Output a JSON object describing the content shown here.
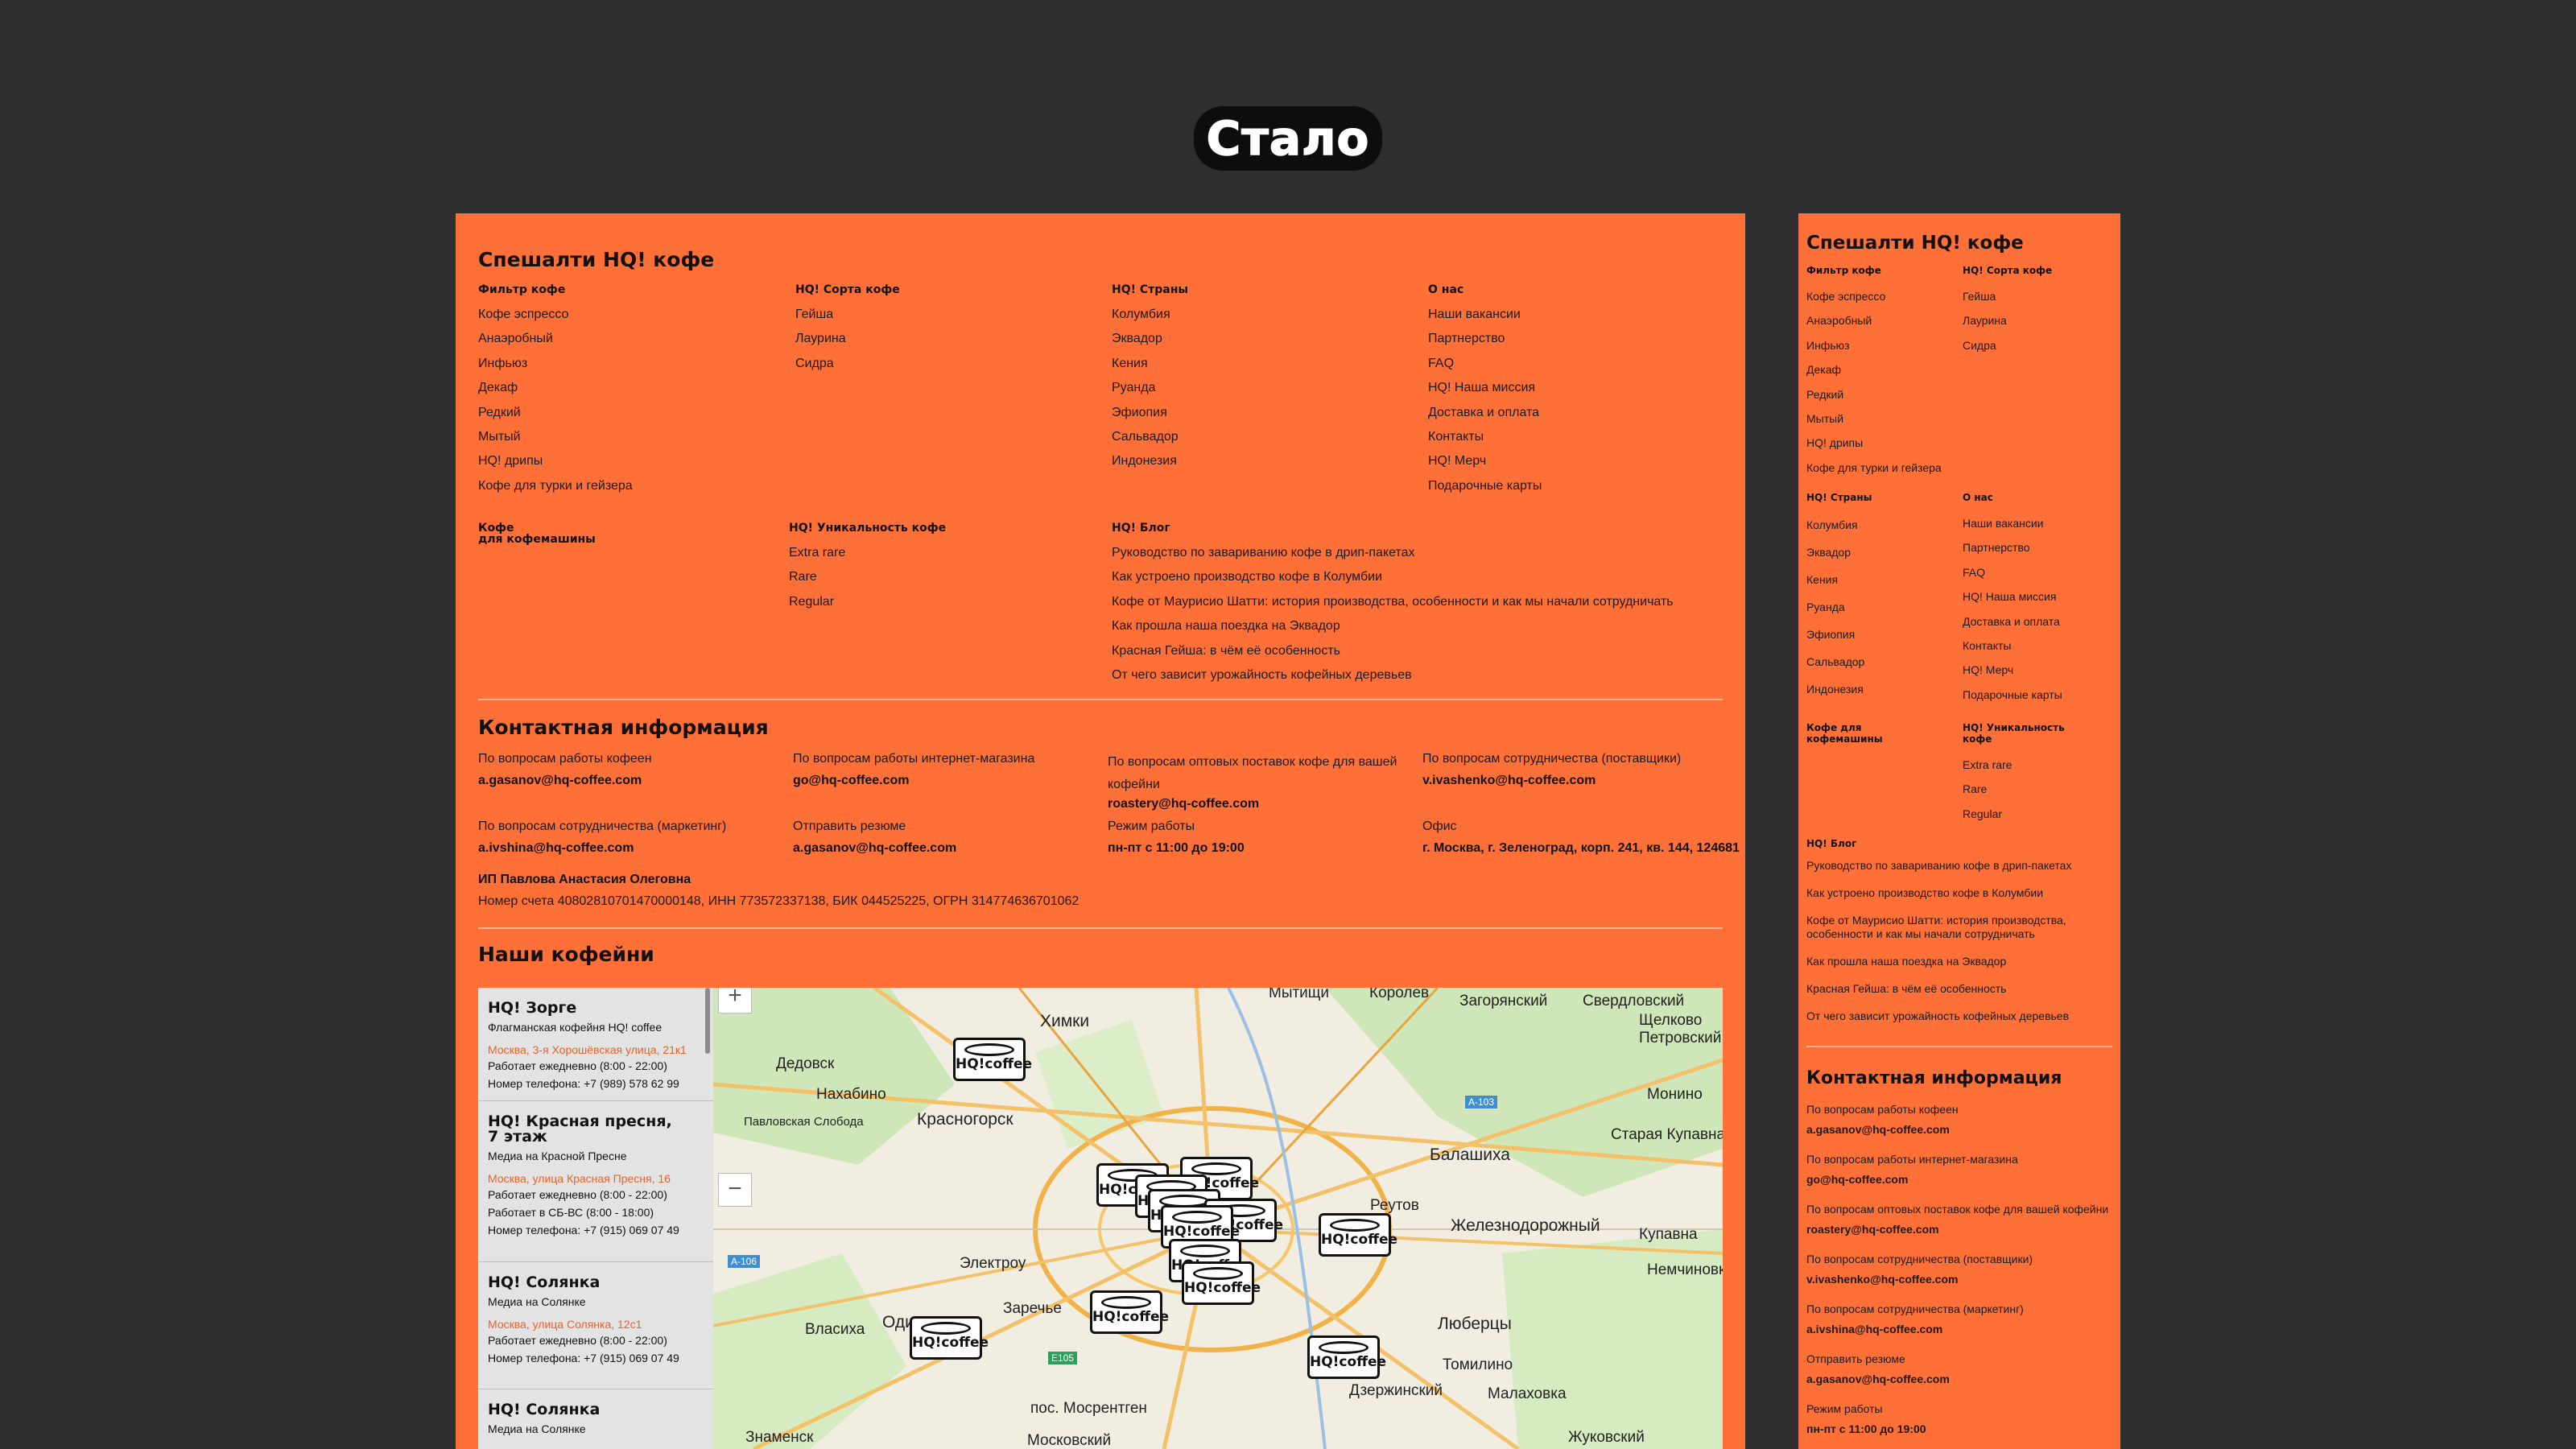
{
  "heading": "Стало",
  "desktop": {
    "catalog_title": "Спешалти HQ! кофе",
    "columns": [
      {
        "title": "Фильтр кофе",
        "items": [
          "Кофе эспрессо",
          "Анаэробный",
          "Инфьюз",
          "Декаф",
          "Редкий",
          "Мытый",
          "HQ! дрипы",
          "Кофе для турки и гейзера"
        ]
      },
      {
        "title": "HQ! Сорта кофе",
        "items": [
          "Гейша",
          "Лаурина",
          "Сидра"
        ]
      },
      {
        "title": "HQ! Страны",
        "items": [
          "Колумбия",
          "Эквадор",
          "Кения",
          "Руанда",
          "Эфиопия",
          "Сальвадор",
          "Индонезия"
        ]
      },
      {
        "title": "О нас",
        "items": [
          "Наши вакансии",
          "Партнерство",
          "FAQ",
          "HQ! Наша миссия",
          "Доставка и оплата",
          "Контакты",
          "HQ! Мерч",
          "Подарочные карты"
        ]
      }
    ],
    "row2": [
      {
        "title_line1": "Кофе",
        "title_line2": "для кофемашины",
        "items": []
      },
      {
        "title": "HQ! Уникальность кофе",
        "items": [
          "Extra rare",
          "Rare",
          "Regular"
        ]
      },
      {
        "title": "HQ! Блог",
        "items": [
          "Руководство по завариванию кофе в дрип-пакетах",
          "Как устроено производство кофе в Колумбии",
          "Кофе от Маурисио Шатти: история производства, особенности и как мы начали сотрудничать",
          "Как прошла наша поездка на Эквадор",
          "Красная Гейша: в чём её особенность",
          "От чего зависит урожайность кофейных деревьев"
        ]
      }
    ],
    "contacts_title": "Контактная информация",
    "contacts": [
      {
        "label": "По вопросам работы кофеен",
        "value": "a.gasanov@hq-coffee.com"
      },
      {
        "label": "По вопросам работы интернет-магазина",
        "value": "go@hq-coffee.com"
      },
      {
        "label": "По вопросам оптовых поставок кофе для вашей кофейни",
        "value": "roastery@hq-coffee.com"
      },
      {
        "label": "По вопросам сотрудничества (поставщики)",
        "value": "v.ivashenko@hq-coffee.com"
      },
      {
        "label": "По вопросам сотрудничества (маркетинг)",
        "value": "a.ivshina@hq-coffee.com"
      },
      {
        "label": "Отправить резюме",
        "value": "a.gasanov@hq-coffee.com"
      },
      {
        "label": "Режим работы",
        "value": "пн-пт с 11:00 до 19:00"
      },
      {
        "label": "Офис",
        "value": "г. Москва, г. Зеленоград, корп. 241, кв. 144, 124681"
      }
    ],
    "legal_name": "ИП Павлова Анастасия Олеговна",
    "legal_details": "Номер счета 40802810701470000148, ИНН 773572337138, БИК 044525225, ОГРН 314774636701062",
    "cafes_title": "Наши кофейни",
    "shops": [
      {
        "name": "HQ! Зорге",
        "desc": "Флагманская кофейня HQ! coffee",
        "address": "Москва, 3-я Хорошёвская улица, 21к1",
        "hours": [
          "Работает ежедневно (8:00 - 22:00)"
        ],
        "phone": "Номер телефона: +7 (989) 578 62 99"
      },
      {
        "name_line1": "HQ! Красная пресня,",
        "name_line2": "7 этаж",
        "desc": "Медиа на Красной Пресне",
        "address": "Москва, улица Красная Пресня, 16",
        "hours": [
          "Работает ежедневно (8:00 - 22:00)",
          "Работает в СБ-ВС (8:00 - 18:00)"
        ],
        "phone": "Номер телефона: +7 (915) 069 07 49"
      },
      {
        "name": "HQ! Солянка",
        "desc": "Медиа на Солянке",
        "address": "Москва, улица Солянка, 12с1",
        "hours": [
          "Работает ежедневно (8:00 - 22:00)"
        ],
        "phone": "Номер телефона: +7 (915) 069 07 49"
      },
      {
        "name": "HQ! Солянка",
        "desc": "Медиа на Солянке"
      }
    ],
    "map_labels": [
      "Мытищи",
      "Королев",
      "Загорянский",
      "Свердловский",
      "Химки",
      "Щелково",
      "Петровский",
      "Дедовск",
      "Нахабино",
      "Красногорск",
      "Монино",
      "Павловская Слобода",
      "Балашиха",
      "Старая Купавна",
      "Реутов",
      "Железнодорожный",
      "Купавна",
      "Немчиновка",
      "Электроу",
      "Заречье",
      "Одинцово",
      "Власиха",
      "Люберцы",
      "Томилино",
      "Дзержинский",
      "Малаховка",
      "пос. Мосрентген",
      "Жуковский",
      "Московский",
      "Знаменск"
    ],
    "road_labels": [
      "A-103",
      "A-106",
      "E105"
    ],
    "marker_text": "HQ!coffee",
    "zoom_in": "+",
    "zoom_out": "−"
  },
  "mobile": {
    "catalog_title": "Спешалти HQ! кофе",
    "filter_title": "Фильтр кофе",
    "filter_items": [
      "Кофе эспрессо",
      "Анаэробный",
      "Инфьюз",
      "Декаф",
      "Редкий",
      "Мытый",
      "HQ! дрипы",
      "Кофе для турки и гейзера"
    ],
    "sorts_title": "HQ! Сорта кофе",
    "sorts_items": [
      "Гейша",
      "Лаурина",
      "Сидра"
    ],
    "countries_title": "HQ! Страны",
    "countries_items": [
      "Колумбия",
      "Эквадор",
      "Кения",
      "Руанда",
      "Эфиопия",
      "Сальвадор",
      "Индонезия"
    ],
    "about_title": "О нас",
    "about_items": [
      "Наши вакансии",
      "Партнерство",
      "FAQ",
      "HQ! Наша миссия",
      "Доставка и оплата",
      "Контакты",
      "HQ! Мерч",
      "Подарочные карты"
    ],
    "machine_title_line1": "Кофе для",
    "machine_title_line2": "кофемашины",
    "unique_title_line1": "HQ! Уникальность",
    "unique_title_line2": "кофе",
    "unique_items": [
      "Extra rare",
      "Rare",
      "Regular"
    ],
    "blog_title": "HQ! Блог",
    "blog_items": [
      "Руководство по завариванию кофе в дрип-пакетах",
      "Как устроено производство кофе в Колумбии",
      "Кофе от Маурисио Шатти: история производства, особенности и как мы начали сотрудничать",
      "Как прошла наша поездка на Эквадор",
      "Красная Гейша: в чём её особенность",
      "От чего зависит урожайность кофейных деревьев"
    ],
    "contacts_title": "Контактная информация",
    "contacts": [
      {
        "label": "По вопросам работы кофеен",
        "value": "a.gasanov@hq-coffee.com"
      },
      {
        "label": "По вопросам работы интернет-магазина",
        "value": "go@hq-coffee.com"
      },
      {
        "label": "По вопросам оптовых поставок кофе для вашей кофейни",
        "value": "roastery@hq-coffee.com"
      },
      {
        "label": "По вопросам сотрудничества (поставщики)",
        "value": "v.ivashenko@hq-coffee.com"
      },
      {
        "label": "По вопросам сотрудничества (маркетинг)",
        "value": "a.ivshina@hq-coffee.com"
      },
      {
        "label": "Отправить резюме",
        "value": "a.gasanov@hq-coffee.com"
      },
      {
        "label": "Режим работы",
        "value": "пн-пт с 11:00 до 19:00"
      }
    ]
  },
  "colors": {
    "background": "#2e2e2e",
    "panel": "#ff7038",
    "address": "#e8612c",
    "text": "#1a1a1a"
  }
}
